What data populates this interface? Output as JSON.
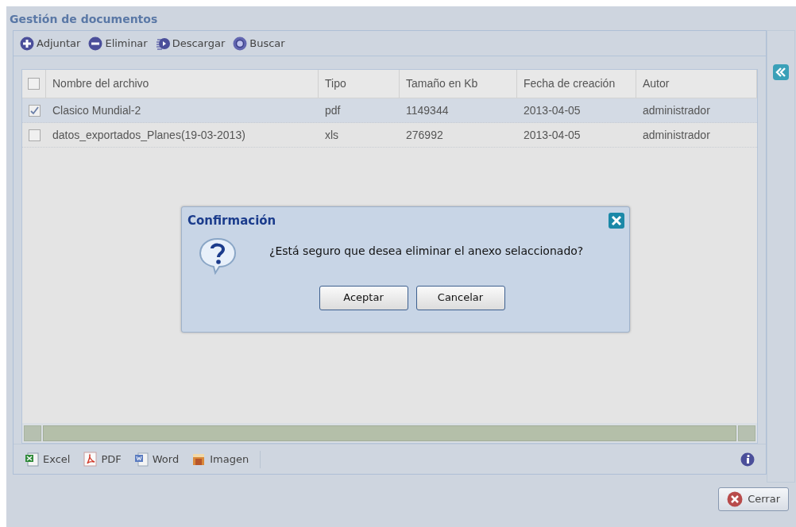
{
  "window": {
    "title": "Gestión de documentos"
  },
  "toolbar": [
    {
      "kind": "add",
      "label": "Adjuntar"
    },
    {
      "kind": "remove",
      "label": "Eliminar"
    },
    {
      "kind": "download",
      "label": "Descargar"
    },
    {
      "kind": "search",
      "label": "Buscar"
    }
  ],
  "table": {
    "select_all": {
      "checked": false
    },
    "columns": [
      "Nombre del archivo",
      "Tipo",
      "Tamaño en Kb",
      "Fecha de creación",
      "Autor"
    ],
    "rows": [
      {
        "checked": true,
        "selected": true,
        "cells": [
          "Clasico Mundial-2",
          "pdf",
          "1149344",
          "2013-04-05",
          "administrador"
        ]
      },
      {
        "checked": false,
        "selected": false,
        "cells": [
          "datos_exportados_Planes(19-03-2013)",
          "xls",
          "276992",
          "2013-04-05",
          "administrador"
        ]
      }
    ]
  },
  "export": [
    {
      "kind": "excel",
      "label": "Excel"
    },
    {
      "kind": "pdf",
      "label": "PDF"
    },
    {
      "kind": "word",
      "label": "Word"
    },
    {
      "kind": "image",
      "label": "Imagen"
    }
  ],
  "dialog": {
    "title": "Confirmación",
    "message": "¿Está seguro que desea eliminar el anexo selaccionado?",
    "buttons": [
      "Aceptar",
      "Cancelar"
    ]
  },
  "close_button": {
    "label": "Cerrar"
  }
}
